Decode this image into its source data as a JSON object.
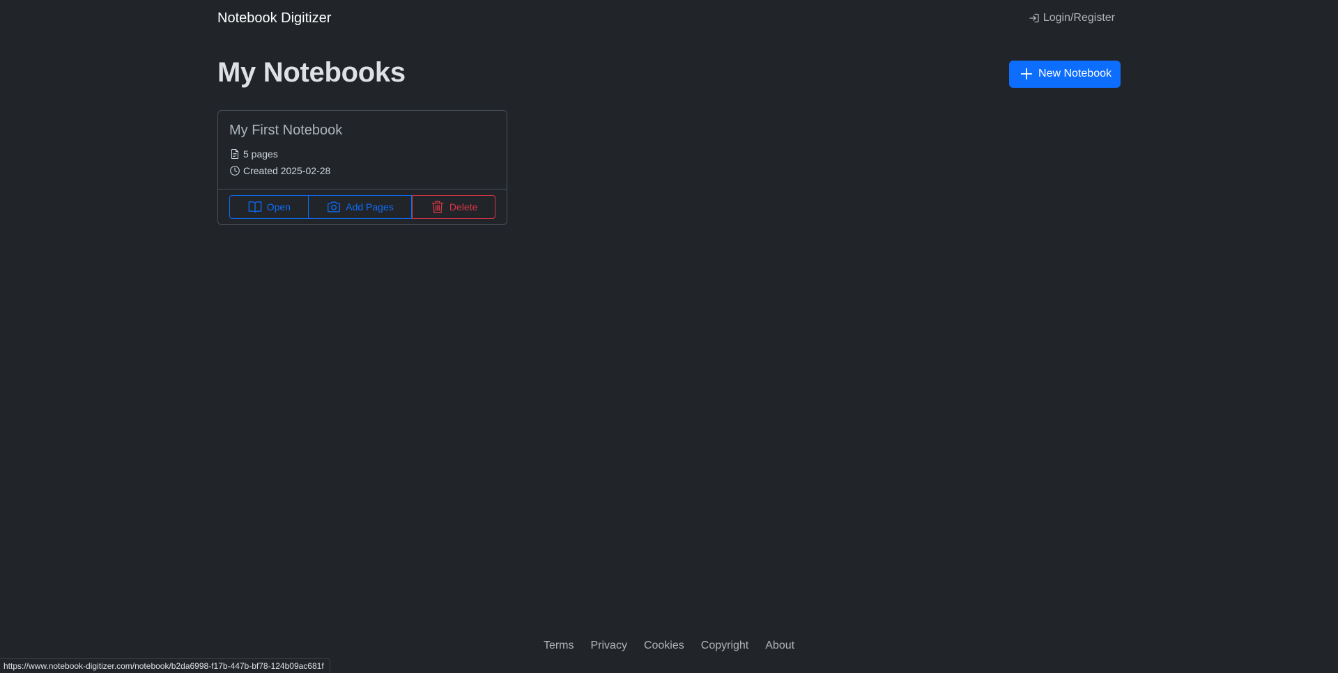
{
  "navbar": {
    "brand": "Notebook Digitizer",
    "login_label": "Login/Register",
    "login_icon": "box-arrow-in-right-icon"
  },
  "header": {
    "title": "My Notebooks",
    "new_notebook_label": "New Notebook",
    "new_notebook_icon": "plus-icon"
  },
  "notebooks": [
    {
      "title": "My First Notebook",
      "pages": "5 pages",
      "created": "Created 2025-02-28",
      "actions": {
        "open_label": "Open",
        "add_pages_label": "Add Pages",
        "delete_label": "Delete"
      }
    }
  ],
  "footer": {
    "links": [
      "Terms",
      "Privacy",
      "Cookies",
      "Copyright",
      "About"
    ]
  },
  "status_bar": {
    "url": "https://www.notebook-digitizer.com/notebook/b2da6998-f17b-447b-bf78-124b09ac681f"
  },
  "colors": {
    "background": "#212529",
    "primary": "#0d6efd",
    "danger": "#dc3545"
  }
}
